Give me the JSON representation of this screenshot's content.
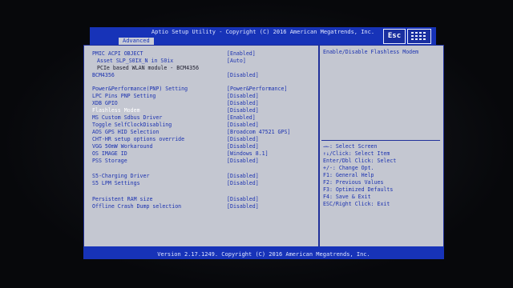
{
  "header": {
    "title": "Aptio Setup Utility - Copyright (C) 2016 American Megatrends, Inc.",
    "tab": "Advanced",
    "esc_label": "Esc"
  },
  "settings": [
    {
      "label": "PMIC ACPI OBJECT",
      "value": "[Enabled]"
    },
    {
      "label": "Asset SLP_S0IX_N in S0ix",
      "value": "[Auto]"
    },
    {
      "label": "PCIe based WLAN module - BCM4356",
      "value": ""
    },
    {
      "label": "BCM4356",
      "value": "[Disabled]"
    },
    {
      "label": "Power&Performance(PNP) Setting",
      "value": "[Power&Performance]"
    },
    {
      "label": "LPC Pins PNP Setting",
      "value": "[Disabled]"
    },
    {
      "label": "XDB GPIO",
      "value": "[Disabled]"
    },
    {
      "label": "Flashless Modem",
      "value": "[Disabled]"
    },
    {
      "label": "MS Custom Sdbus Driver",
      "value": "[Enabled]"
    },
    {
      "label": "Toggle SelfClockDisabling",
      "value": "[Disabled]"
    },
    {
      "label": "AOS GPS HID Selection",
      "value": "[Broadcom 47521 GPS]"
    },
    {
      "label": "CHT-HR setup options override",
      "value": "[Disabled]"
    },
    {
      "label": "VGG 50mW Workaround",
      "value": "[Disabled]"
    },
    {
      "label": "OS IMAGE ID",
      "value": "[Windows 8.1]"
    },
    {
      "label": "PSS Storage",
      "value": "[Disabled]"
    },
    {
      "label": "S5-Charging Driver",
      "value": "[Disabled]"
    },
    {
      "label": "S5 LPM Settings",
      "value": "[Disabled]"
    },
    {
      "label": "Persistent RAM size",
      "value": "[Disabled]"
    },
    {
      "label": "Offline Crash Dump selection",
      "value": "[Disabled]"
    }
  ],
  "help": {
    "description": "Enable/Disable Flashless Modem",
    "keys": [
      "→←: Select Screen",
      "↑↓/Click: Select Item",
      "Enter/Dbl Click: Select",
      "+/-: Change Opt.",
      "F1: General Help",
      "F2: Previous Values",
      "F3: Optimized Defaults",
      "F4: Save & Exit",
      "ESC/Right Click: Exit"
    ]
  },
  "footer": {
    "version": "Version 2.17.1249. Copyright (C) 2016 American Megatrends, Inc."
  }
}
